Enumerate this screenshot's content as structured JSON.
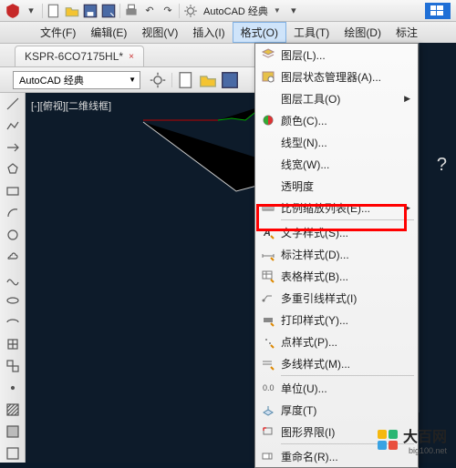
{
  "titlebar": {
    "workspace_dd": "AutoCAD 经典"
  },
  "menubar": {
    "items": [
      "文件(F)",
      "编辑(E)",
      "视图(V)",
      "插入(I)",
      "格式(O)",
      "工具(T)",
      "绘图(D)",
      "标注"
    ]
  },
  "filetab": {
    "name": "KSPR-6CO7175HL*",
    "close": "×"
  },
  "toolbar2": {
    "workspace": "AutoCAD 经典"
  },
  "canvas": {
    "view_label": "[-][俯视][二维线框]"
  },
  "dropdown": {
    "items": [
      {
        "label": "图层(L)..."
      },
      {
        "label": "图层状态管理器(A)..."
      },
      {
        "label": "图层工具(O)",
        "submenu": true
      },
      {
        "label": "颜色(C)..."
      },
      {
        "label": "线型(N)..."
      },
      {
        "label": "线宽(W)..."
      },
      {
        "label": "透明度"
      },
      {
        "label": "比例缩放列表(E)...",
        "submenu": true
      },
      {
        "sep": true
      },
      {
        "label": "文字样式(S)..."
      },
      {
        "label": "标注样式(D)..."
      },
      {
        "label": "表格样式(B)..."
      },
      {
        "label": "多重引线样式(I)"
      },
      {
        "label": "打印样式(Y)..."
      },
      {
        "label": "点样式(P)..."
      },
      {
        "label": "多线样式(M)..."
      },
      {
        "sep": true
      },
      {
        "label": "单位(U)..."
      },
      {
        "label": "厚度(T)"
      },
      {
        "label": "图形界限(I)"
      },
      {
        "sep": true
      },
      {
        "label": "重命名(R)..."
      }
    ]
  },
  "question_mark": "?",
  "watermark": {
    "text": "大百网",
    "url": "big100.net"
  }
}
